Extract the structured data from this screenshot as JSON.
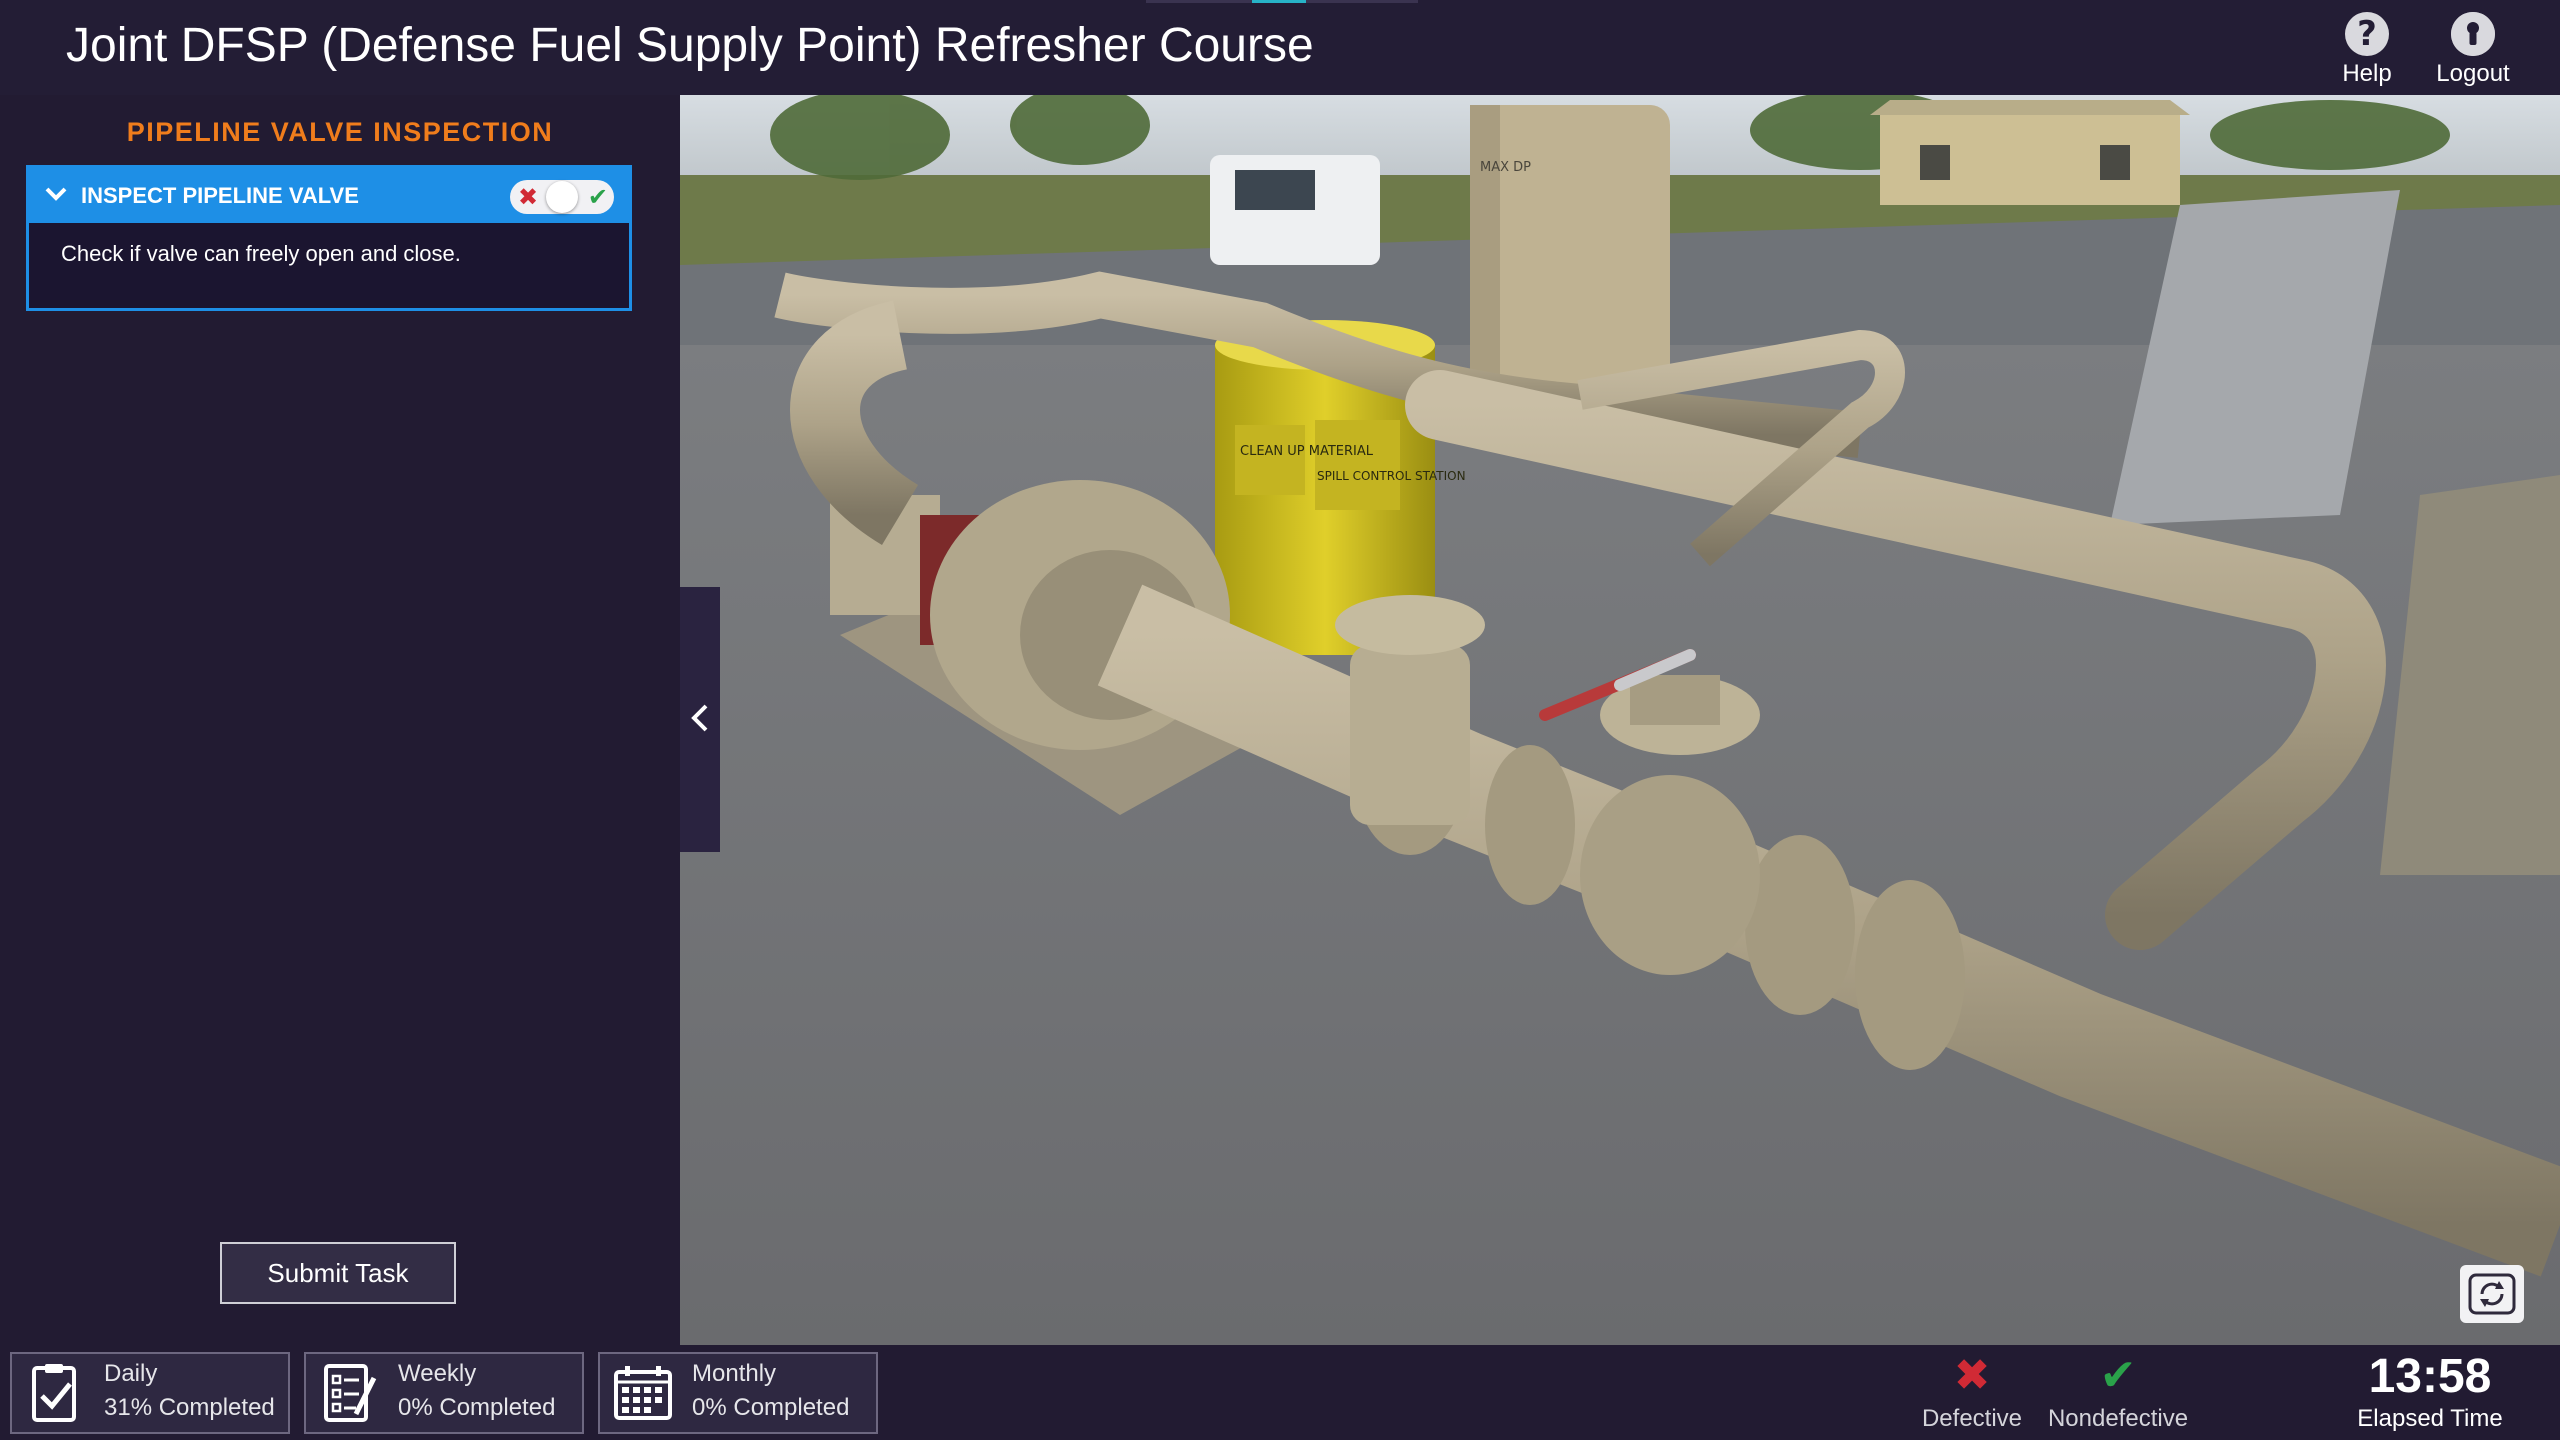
{
  "header": {
    "title": "Joint DFSP (Defense Fuel Supply Point) Refresher Course",
    "help_label": "Help",
    "logout_label": "Logout"
  },
  "task_panel": {
    "section_title": "PIPELINE VALVE INSPECTION",
    "task": {
      "name": "INSPECT PIPELINE VALVE",
      "description": "Check if valve can freely open and close.",
      "expanded": true
    },
    "submit_label": "Submit Task"
  },
  "schedules": [
    {
      "name": "Daily",
      "progress": "31% Completed",
      "icon": "clipboard-check-icon"
    },
    {
      "name": "Weekly",
      "progress": "0% Completed",
      "icon": "checklist-icon"
    },
    {
      "name": "Monthly",
      "progress": "0% Completed",
      "icon": "calendar-icon"
    }
  ],
  "verdicts": {
    "defective_label": "Defective",
    "nondefective_label": "Nondefective"
  },
  "timer": {
    "value": "13:58",
    "label": "Elapsed Time"
  },
  "scene": {
    "stencil_drum": "CLEAN UP MATERIAL",
    "stencil_station": "SPILL CONTROL STATION",
    "stencil_tank": "MAX DP"
  },
  "colors": {
    "background": "#221b32",
    "accent_orange": "#f07d1c",
    "accent_blue": "#1e8fe6",
    "defective_red": "#d12a35",
    "nondefective_green": "#2aa24a"
  }
}
